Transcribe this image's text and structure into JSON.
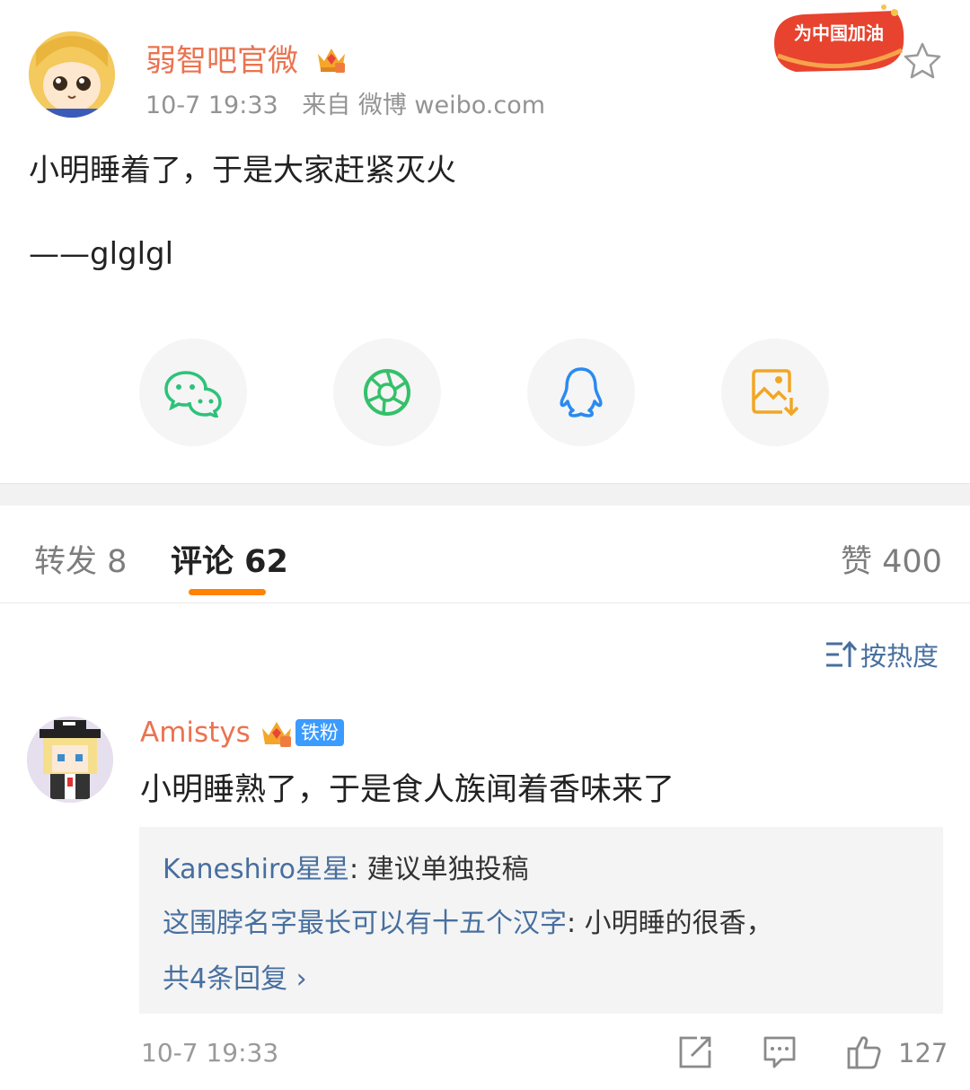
{
  "post": {
    "username": "弱智吧官微",
    "time": "10-7 19:33",
    "source": "来自 微博 weibo.com",
    "promo": "为中国加油",
    "line1": "小明睡着了，于是大家赶紧灭火",
    "line2": "——glglgl"
  },
  "share": [
    "wechat-icon",
    "moments-icon",
    "qq-icon",
    "save-image-icon"
  ],
  "tabs": {
    "repost": "转发 8",
    "comment": "评论 62",
    "like": "赞 400"
  },
  "sort_label": "按热度",
  "comment": {
    "username": "Amistys",
    "badge": "铁粉",
    "text": "小明睡熟了，于是食人族闻着香味来了",
    "replies": [
      {
        "user": "Kaneshiro星星",
        "text": ": 建议单独投稿"
      },
      {
        "user": "这围脖名字最长可以有十五个汉字",
        "text": ": 小明睡的很香，"
      }
    ],
    "more_replies": "共4条回复 ›",
    "time": "10-7 19:33",
    "like_count": "127"
  },
  "colors": {
    "username": "#eb7350",
    "link": "#476f9f",
    "tab_accent": "#ff8200"
  }
}
